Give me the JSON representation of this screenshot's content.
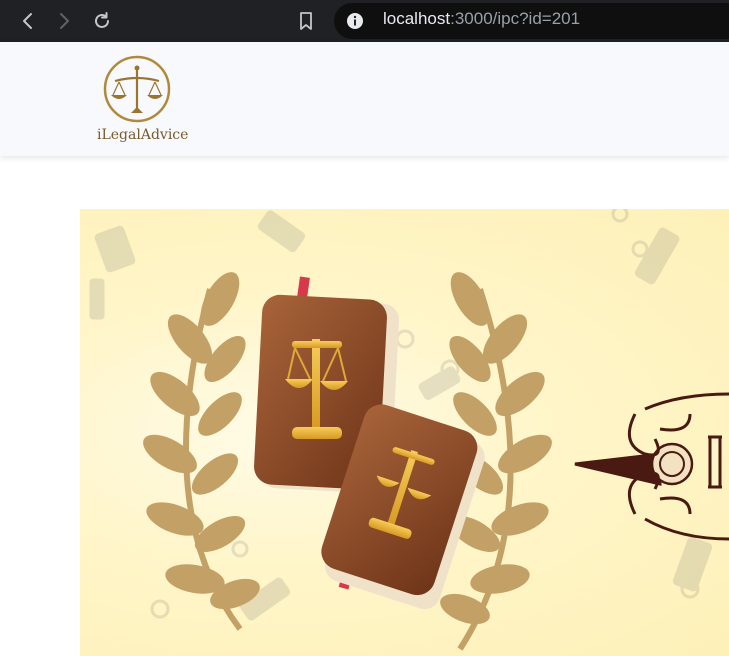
{
  "browser": {
    "url_host": "localhost",
    "url_rest": ":3000/ipc?id=201",
    "icons": [
      "back-icon",
      "forward-icon",
      "reload-icon",
      "bookmark-icon",
      "site-info-icon"
    ]
  },
  "site": {
    "brand_name": "iLegalAdvice"
  },
  "colors": {
    "gold": "#b08a3a",
    "leather": "#8a4a25",
    "scroll_outline": "#4a1a12",
    "hero_bg": "#fff5c8"
  }
}
